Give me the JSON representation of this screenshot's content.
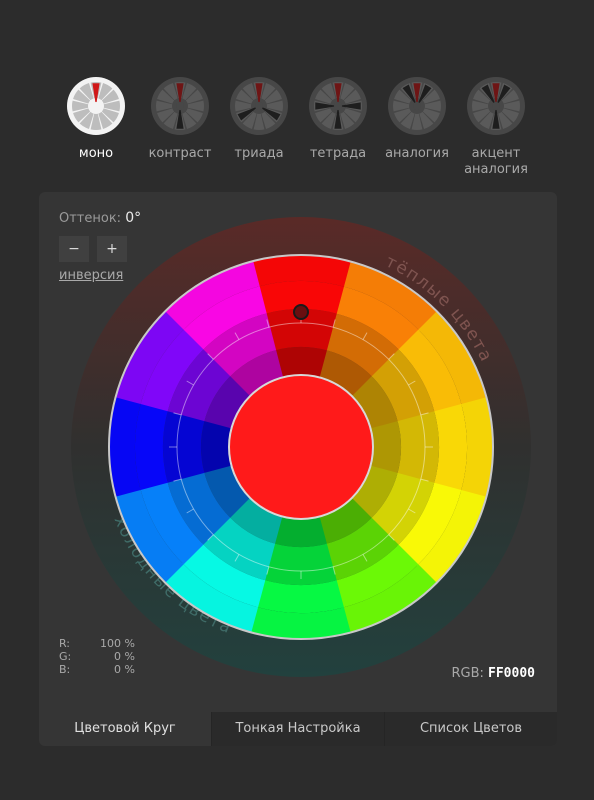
{
  "schemes": [
    {
      "label": "моно",
      "active": true,
      "icon": "mono-scheme-icon"
    },
    {
      "label": "контраст",
      "active": false,
      "icon": "contrast-scheme-icon"
    },
    {
      "label": "триада",
      "active": false,
      "icon": "triad-scheme-icon"
    },
    {
      "label": "тетрада",
      "active": false,
      "icon": "tetrad-scheme-icon"
    },
    {
      "label": "аналогия",
      "active": false,
      "icon": "analogy-scheme-icon"
    },
    {
      "label": "акцент аналогия",
      "active": false,
      "icon": "accent-analogy-scheme-icon"
    }
  ],
  "hue": {
    "label": "Оттенок:",
    "value": "0°"
  },
  "buttons": {
    "minus": "−",
    "plus": "+"
  },
  "inversion": "инверсия",
  "wheel": {
    "warm_label": "тёплые цвета",
    "cold_label": "холодные цвета",
    "center_color": "#ff1a1a",
    "selected_hue_deg": 0
  },
  "rgb": {
    "r_label": "R:",
    "r_value": "100 %",
    "g_label": "G:",
    "g_value": "0 %",
    "b_label": "B:",
    "b_value": "0 %",
    "hex_label": "RGB:",
    "hex_value": "FF0000"
  },
  "tabs": [
    {
      "label": "Цветовой Круг",
      "active": true
    },
    {
      "label": "Тонкая Настройка",
      "active": false
    },
    {
      "label": "Список Цветов",
      "active": false
    }
  ],
  "colors": {
    "background": "#2c2c2c",
    "panel": "#353535",
    "warm_arc": "#5a2a27",
    "cold_arc": "#22413e",
    "active_icon_red": "#d01717"
  }
}
